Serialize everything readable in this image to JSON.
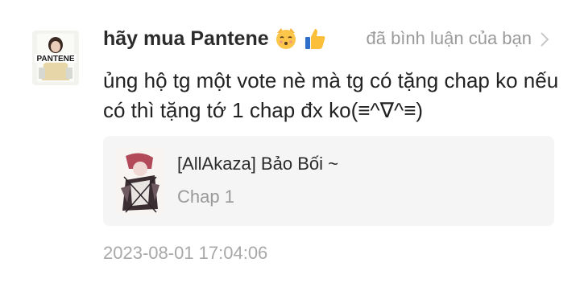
{
  "comment": {
    "username": "hãy mua Pantene",
    "username_emojis": [
      "kissing-cat-emoji",
      "thumbs-up-emoji"
    ],
    "action_text": "đã bình luận của bạn",
    "avatar_logo_text": "PANTENE",
    "text": "ủng hộ tg một vote nè mà tg có tặng chap ko nếu có thì tặng tớ 1 chap đx ko(≡^∇^≡)",
    "timestamp": "2023-08-01 17:04:06"
  },
  "card": {
    "title": "[AllAkaza] Bảo Bối ~",
    "subtitle": "Chap 1"
  },
  "icons": {
    "chevron": "chevron-right-icon"
  },
  "colors": {
    "card_bg": "#f5f5f5",
    "muted_text": "#9a9a9a",
    "primary_text": "#222222"
  }
}
